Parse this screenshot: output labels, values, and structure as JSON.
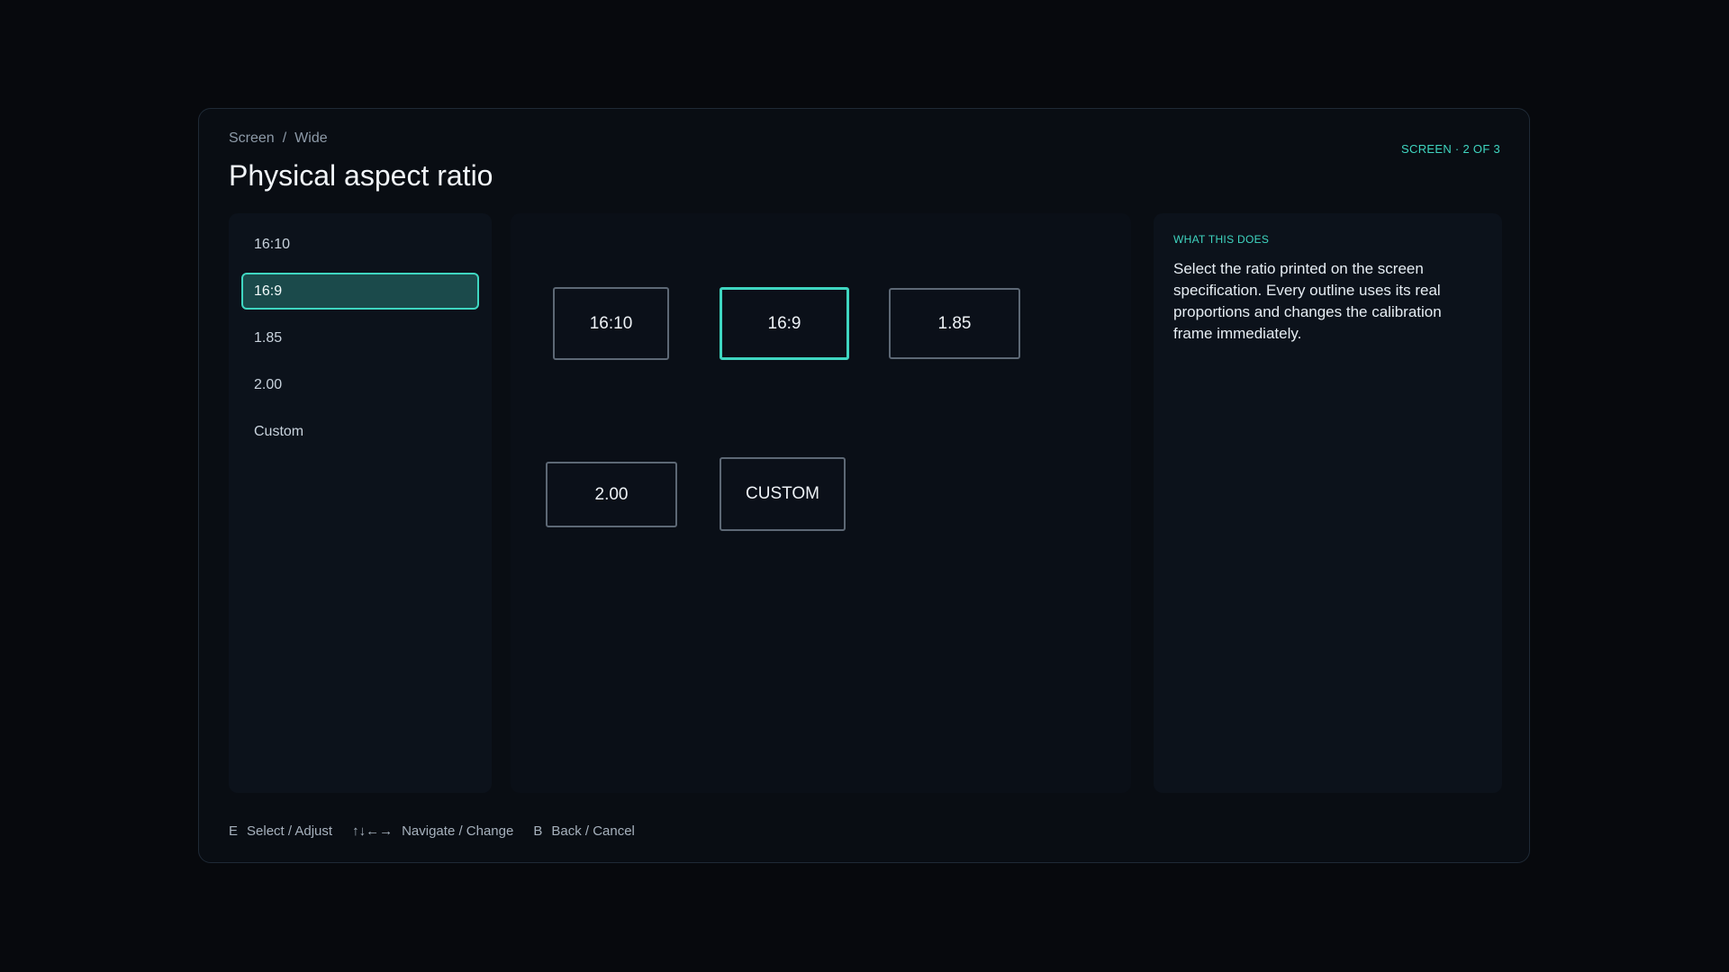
{
  "breadcrumb": {
    "parent": "Screen",
    "separator": "/",
    "current": "Wide"
  },
  "page_title": "Physical aspect ratio",
  "screen_indicator": "SCREEN · 2 OF 3",
  "list": {
    "items": [
      {
        "label": "16:10",
        "selected": false
      },
      {
        "label": "16:9",
        "selected": true
      },
      {
        "label": "1.85",
        "selected": false
      },
      {
        "label": "2.00",
        "selected": false
      },
      {
        "label": "Custom",
        "selected": false
      }
    ]
  },
  "preview": {
    "boxes": [
      {
        "label": "16:10",
        "selected": false
      },
      {
        "label": "16:9",
        "selected": true
      },
      {
        "label": "1.85",
        "selected": false
      },
      {
        "label": "2.00",
        "selected": false
      },
      {
        "label": "CUSTOM",
        "selected": false
      }
    ]
  },
  "info": {
    "heading": "WHAT THIS DOES",
    "text": "Select the ratio printed on the screen specification. Every outline uses its real proportions and changes the calibration frame immediately."
  },
  "footer": {
    "hints": [
      {
        "key": "E",
        "label": "Select / Adjust"
      },
      {
        "key": "↑↓←→",
        "label": "Navigate / Change"
      },
      {
        "key": "B",
        "label": "Back / Cancel"
      }
    ]
  },
  "colors": {
    "accent": "#3fd6c1",
    "background": "#07090d",
    "selected_fill": "#1b4a4b"
  }
}
